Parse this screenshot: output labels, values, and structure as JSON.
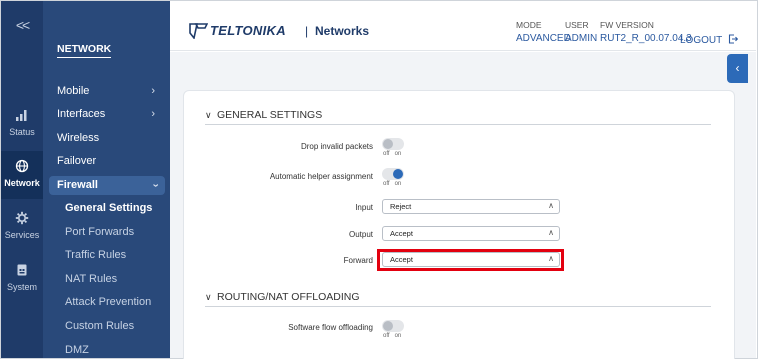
{
  "rail": {
    "collapse": "<<",
    "items": [
      {
        "label": "Status",
        "icon": "status-bars-icon"
      },
      {
        "label": "Network",
        "icon": "globe-icon"
      },
      {
        "label": "Services",
        "icon": "gear-icon"
      },
      {
        "label": "System",
        "icon": "system-icon"
      }
    ]
  },
  "menu": {
    "title": "NETWORK",
    "items": [
      "Mobile",
      "Interfaces",
      "Wireless",
      "Failover",
      "Firewall"
    ],
    "submenu": [
      "General Settings",
      "Port Forwards",
      "Traffic Rules",
      "NAT Rules",
      "Attack Prevention",
      "Custom Rules",
      "DMZ"
    ]
  },
  "header": {
    "brand": "TELTONIKA",
    "separator": "|",
    "product": "Networks",
    "mode_label": "MODE",
    "mode_value": "ADVANCED",
    "user_label": "USER",
    "user_value": "ADMIN",
    "fw_label": "FW VERSION",
    "fw_value": "RUT2_R_00.07.04.3",
    "logout": "LOGOUT"
  },
  "general": {
    "title": "GENERAL SETTINGS",
    "drop_invalid_label": "Drop invalid packets",
    "drop_invalid_state": "off",
    "helper_label": "Automatic helper assignment",
    "helper_state": "on",
    "toggle_off": "off",
    "toggle_on": "on",
    "input_label": "Input",
    "input_value": "Reject",
    "output_label": "Output",
    "output_value": "Accept",
    "forward_label": "Forward",
    "forward_value": "Accept"
  },
  "routing": {
    "title": "ROUTING/NAT OFFLOADING",
    "sw_offload_label": "Software flow offloading",
    "sw_offload_state": "off"
  },
  "colors": {
    "rail": "#1f3b69",
    "menu": "#29497a",
    "accent": "#2c6ab8",
    "highlight": "#e3000f"
  }
}
